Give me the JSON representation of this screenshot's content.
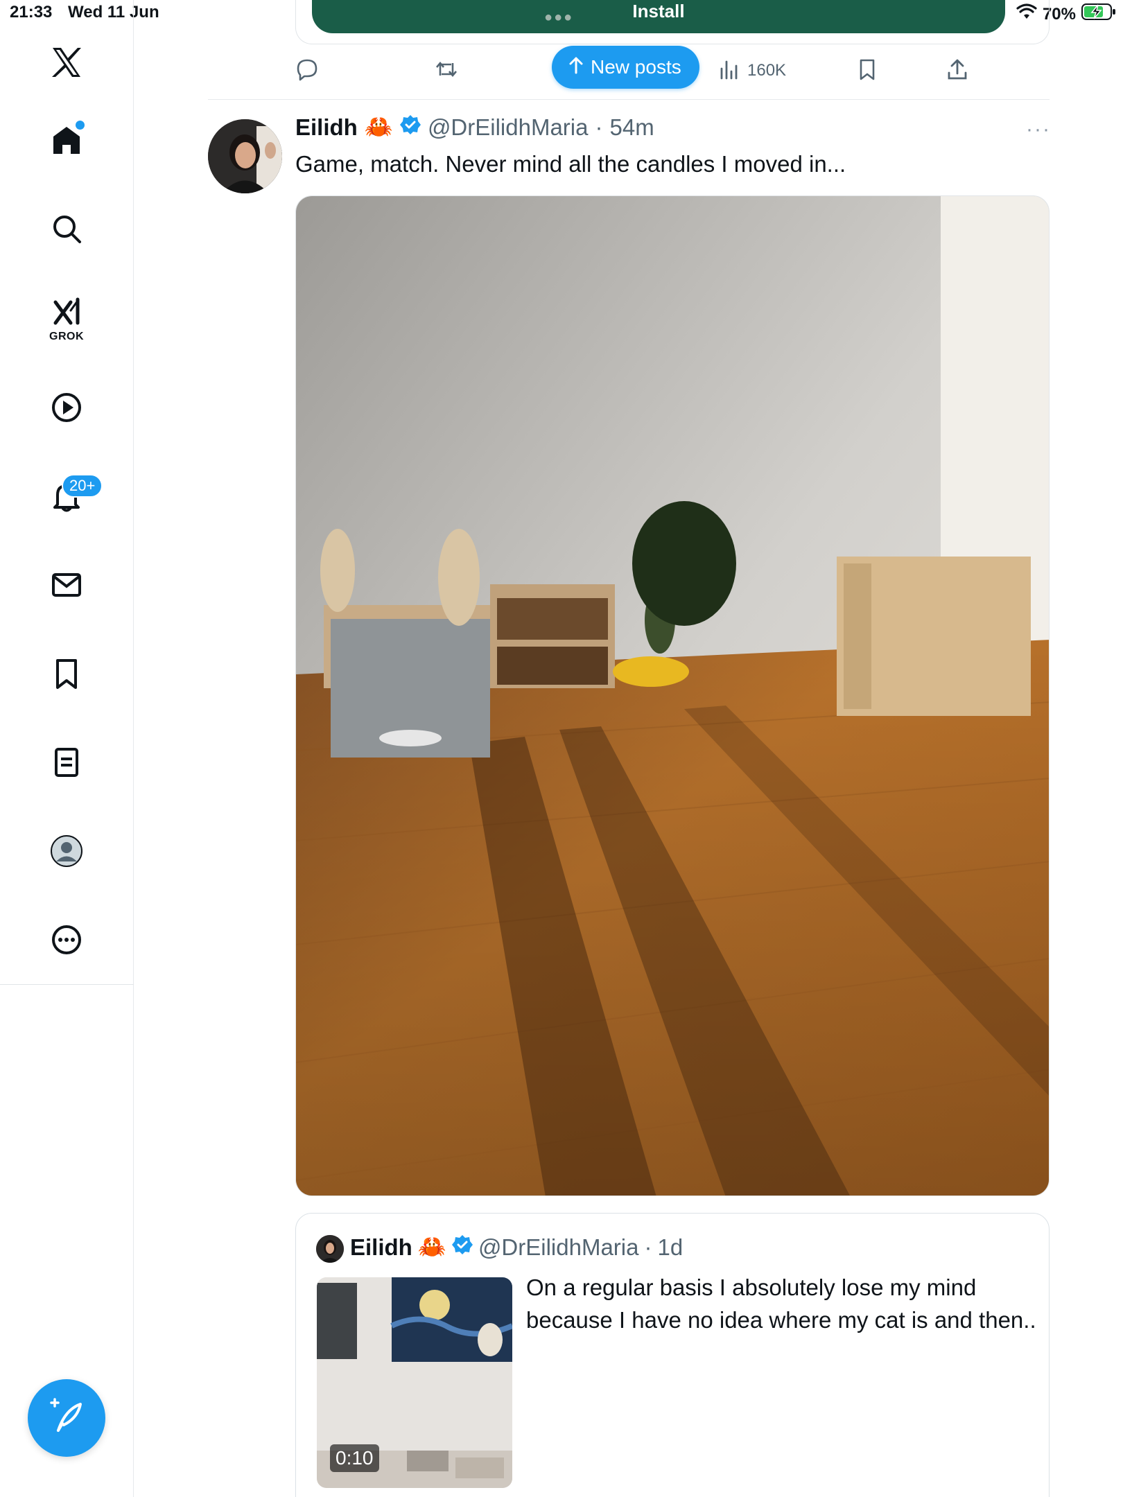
{
  "status_bar": {
    "time": "21:33",
    "date": "Wed 11 Jun",
    "battery": "70%"
  },
  "install_bar": {
    "label": "Install"
  },
  "action_bar": {
    "new_posts_label": "New posts",
    "views": "160K"
  },
  "sidebar": {
    "grok_label": "GROK",
    "notifications_badge": "20+"
  },
  "post": {
    "name": "Eilidh",
    "emoji": "🦀",
    "handle": "@DrEilidhMaria",
    "separator": "·",
    "time": "54m",
    "text": "Game, match. Never mind all the candles I moved in...",
    "more": "···"
  },
  "quoted_post": {
    "name": "Eilidh",
    "emoji": "🦀",
    "handle": "@DrEilidhMaria",
    "separator": "·",
    "time": "1d",
    "text": "On a regular basis I absolutely lose my mind because I have no idea where my cat is and then..",
    "video_duration": "0:10"
  },
  "colors": {
    "accent": "#1d9bf0",
    "install_green": "#1a5d48",
    "text_secondary": "#536471"
  }
}
